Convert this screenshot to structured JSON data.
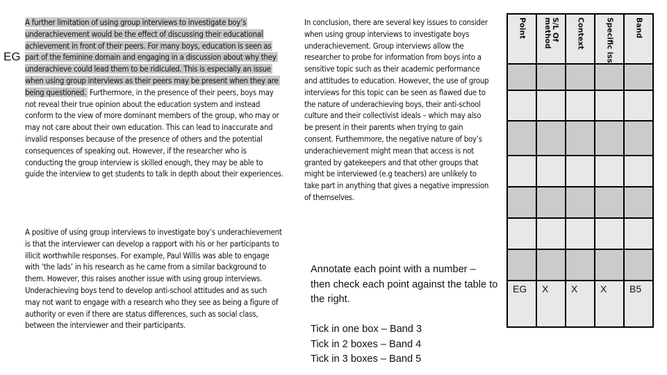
{
  "left_column": {
    "eg_label": "EG",
    "paragraph_1": {
      "highlighted": "A further limitation of using group interviews to investigate boy’s underachievement would be the effect of discussing their educational achievement in front of their peers. For many boys, education is seen as part of the feminine domain and engaging in a discussion about why they underachieve could lead them to be ridiculed. This is especially an issue when using group interviews as their peers may be present when they are being questioned.",
      "rest": " Furthermore, in the presence of their peers, boys may not reveal their true opinion about the education system and instead conform to the view of more dominant members of the group, who may or may not care about their own education. This can lead to inaccurate and invalid responses because of the presence of others and the potential consequences of speaking out. However, if the researcher who is conducting the group interview is skilled enough, they may be able to guide the interview to get students to talk in depth about their experiences."
    },
    "paragraph_2": "A positive of using group interviews to investigate boy’s underachievement is that the interviewer can develop a rapport with his or her participants to illicit worthwhile responses. For example, Paul Willis was able to engage with ‘the lads’ in his research as he came from a similar background to them. However, this raises another issue with using group interviews. Underachieving boys tend to develop anti-school attitudes and as such may not want to engage with a research who they see as being a figure of authority or even if there are status differences, such as social class, between the interviewer and their participants."
  },
  "middle_column": {
    "conclusion": "In conclusion, there are several key issues to consider when using group interviews to investigate boys underachievement. Group interviews allow the researcher to probe for information from boys into a sensitive topic such as their academic performance and attitudes to education. However, the use of group interviews for this topic can be seen as flawed due to the nature of underachieving boys, their anti-school culture and their collectivist ideals – which may also be present in their parents when trying to gain consent. Furthemmore, the negative nature of boy’s underachievement might mean that access is not granted by gatekeepers and that other groups that might be interviewed (e.g teachers) are unlikely to take part in anything that gives a negative impression of themselves.",
    "instructions": {
      "line_1": "Annotate each point with a number – then check each point against the table to the right.",
      "bands": [
        "Tick in one box – Band 3",
        "Tick in 2 boxes – Band 4",
        "Tick in 3 boxes – Band 5"
      ]
    }
  },
  "table": {
    "columns": [
      {
        "header": "Point",
        "values": [
          "",
          "",
          "",
          "",
          "",
          "",
          "",
          "EG"
        ]
      },
      {
        "header": "S/L Of\nmethod",
        "values": [
          "",
          "",
          "",
          "",
          "",
          "",
          "",
          "X"
        ]
      },
      {
        "header": "Context",
        "values": [
          "",
          "",
          "",
          "",
          "",
          "",
          "",
          "X"
        ]
      },
      {
        "header": "Specific issue",
        "values": [
          "",
          "",
          "",
          "",
          "",
          "",
          "",
          "X"
        ]
      },
      {
        "header": "Band",
        "values": [
          "",
          "",
          "",
          "",
          "",
          "",
          "",
          "B5"
        ]
      }
    ],
    "colors": {
      "light": "#e8e8e8",
      "dark": "#cbcbcb",
      "border": "#000000"
    }
  },
  "colors": {
    "highlight": "#c8c8c8"
  }
}
